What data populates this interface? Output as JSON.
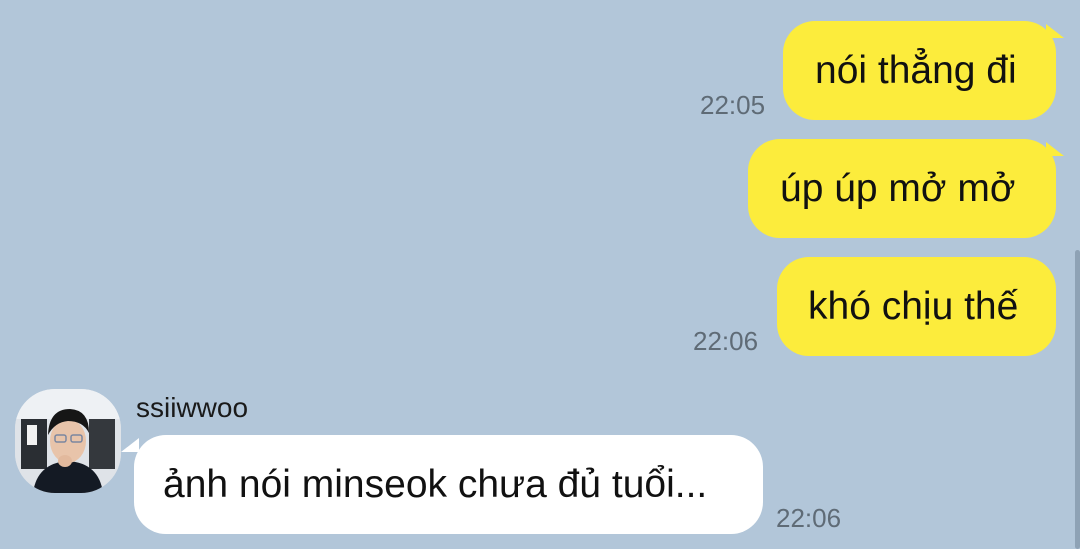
{
  "colors": {
    "chat_background": "#b2c6d9",
    "outgoing_bubble": "#fcec3c",
    "incoming_bubble": "#ffffff",
    "timestamp": "#5f6b76"
  },
  "messages": [
    {
      "direction": "outgoing",
      "text": "nói thẳng đi",
      "time": "22:05"
    },
    {
      "direction": "outgoing",
      "text": "úp úp mở mở",
      "time": ""
    },
    {
      "direction": "outgoing",
      "text": "khó chịu thế",
      "time": "22:06"
    },
    {
      "direction": "incoming",
      "sender": "ssiiwwoo",
      "avatar_icon": "user-photo-icon",
      "text": "ảnh nói minseok chưa đủ tuổi...",
      "time": "22:06"
    }
  ]
}
